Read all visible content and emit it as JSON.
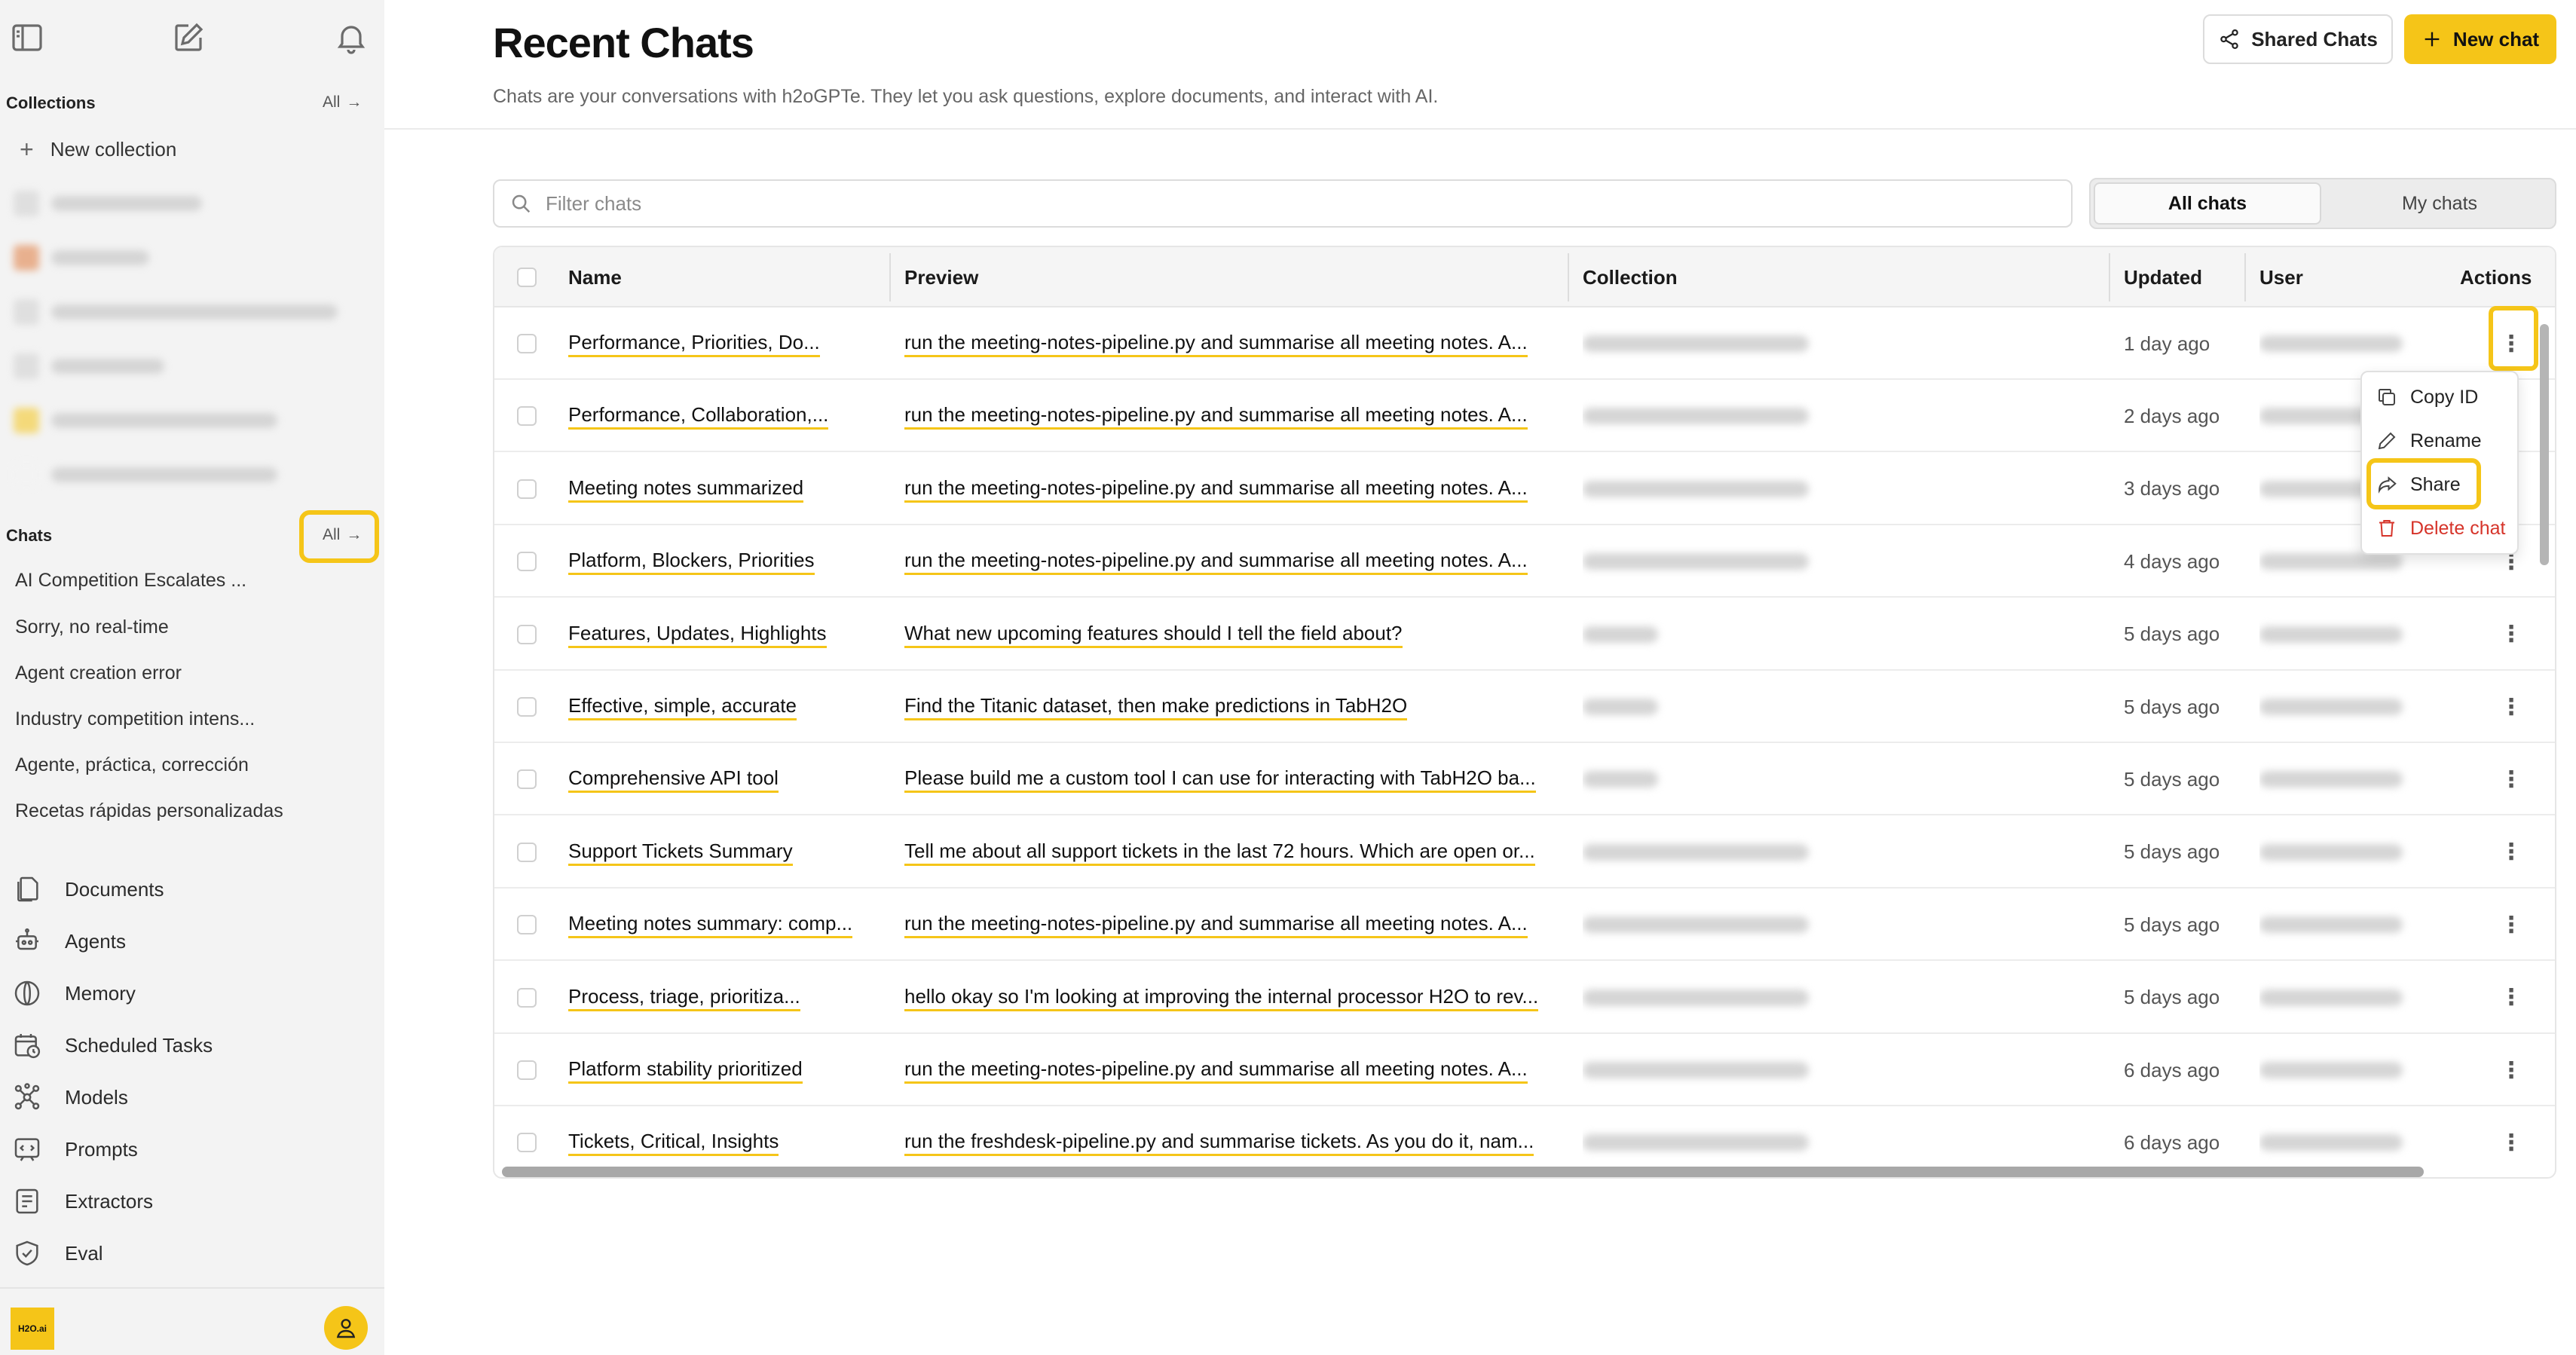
{
  "sidebar": {
    "collections_title": "Collections",
    "collections_all": "All",
    "new_collection": "New collection",
    "chats_title": "Chats",
    "chats_all": "All",
    "chats": [
      "AI Competition Escalates ...",
      "Sorry, no real-time",
      "Agent creation error",
      "Industry competition intens...",
      "Agente, práctica, corrección",
      "Recetas rápidas personalizadas"
    ],
    "nav": [
      {
        "label": "Documents",
        "icon": "documents-icon"
      },
      {
        "label": "Agents",
        "icon": "agents-icon"
      },
      {
        "label": "Memory",
        "icon": "memory-icon"
      },
      {
        "label": "Scheduled Tasks",
        "icon": "scheduled-tasks-icon"
      },
      {
        "label": "Models",
        "icon": "models-icon"
      },
      {
        "label": "Prompts",
        "icon": "prompts-icon"
      },
      {
        "label": "Extractors",
        "icon": "extractors-icon"
      },
      {
        "label": "Eval",
        "icon": "eval-icon"
      }
    ],
    "logo_text": "H2O.ai"
  },
  "header": {
    "title": "Recent Chats",
    "subtitle": "Chats are your conversations with h2oGPTe. They let you ask questions, explore documents, and interact with AI.",
    "shared_chats": "Shared Chats",
    "new_chat": "New chat"
  },
  "filter": {
    "placeholder": "Filter chats"
  },
  "toggle": {
    "all": "All chats",
    "mine": "My chats"
  },
  "table": {
    "columns": {
      "name": "Name",
      "preview": "Preview",
      "collection": "Collection",
      "updated": "Updated",
      "user": "User",
      "actions": "Actions"
    },
    "rows": [
      {
        "name": "Performance, Priorities, Do...",
        "preview": "run the meeting-notes-pipeline.py and summarise all meeting notes. A...",
        "updated": "1 day ago"
      },
      {
        "name": "Performance, Collaboration,...",
        "preview": "run the meeting-notes-pipeline.py and summarise all meeting notes. A...",
        "updated": "2 days ago"
      },
      {
        "name": "Meeting notes summarized",
        "preview": "run the meeting-notes-pipeline.py and summarise all meeting notes. A...",
        "updated": "3 days ago"
      },
      {
        "name": "Platform, Blockers, Priorities",
        "preview": "run the meeting-notes-pipeline.py and summarise all meeting notes. A...",
        "updated": "4 days ago"
      },
      {
        "name": "Features, Updates, Highlights",
        "preview": "What new upcoming features should I tell the field about?",
        "updated": "5 days ago"
      },
      {
        "name": "Effective, simple, accurate",
        "preview": "Find the Titanic dataset, then make predictions in TabH2O",
        "updated": "5 days ago"
      },
      {
        "name": "Comprehensive API tool",
        "preview": "Please build me a custom tool I can use for interacting with TabH2O ba...",
        "updated": "5 days ago"
      },
      {
        "name": "Support Tickets Summary",
        "preview": "Tell me about all support tickets in the last 72 hours. Which are open or...",
        "updated": "5 days ago"
      },
      {
        "name": "Meeting notes summary: comp...",
        "preview": "run the meeting-notes-pipeline.py and summarise all meeting notes. A...",
        "updated": "5 days ago"
      },
      {
        "name": "Process, triage, prioritiza...",
        "preview": "hello okay so I'm looking at improving the internal processor H2O to rev...",
        "updated": "5 days ago"
      },
      {
        "name": "Platform stability prioritized",
        "preview": "run the meeting-notes-pipeline.py and summarise all meeting notes. A...",
        "updated": "6 days ago"
      },
      {
        "name": "Tickets, Critical, Insights",
        "preview": "run the freshdesk-pipeline.py and summarise tickets. As you do it, nam...",
        "updated": "6 days ago"
      }
    ]
  },
  "menu": {
    "copy_id": "Copy ID",
    "rename": "Rename",
    "share": "Share",
    "delete": "Delete chat"
  },
  "colors": {
    "accent": "#f5c518",
    "danger": "#d6342a",
    "sidebar_bg": "#f3f3f3"
  }
}
